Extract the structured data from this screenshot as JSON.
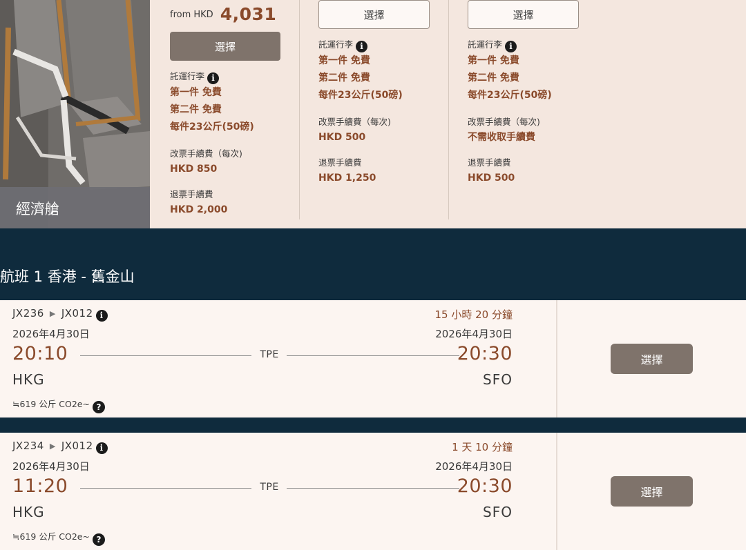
{
  "cabin": {
    "label": "經濟艙"
  },
  "fares": [
    {
      "from_label": "from HKD",
      "from_price": "4,031",
      "select_label": "選擇",
      "baggage_label": "託運行李",
      "baggage_lines": [
        "第一件 免費",
        "第二件 免費",
        "每件23公斤(50磅)"
      ],
      "change_fee_label": "改票手續費（每次)",
      "change_fee_value": "HKD 850",
      "refund_fee_label": "退票手續費",
      "refund_fee_value": "HKD 2,000"
    },
    {
      "select_label": "選擇",
      "baggage_label": "託運行李",
      "baggage_lines": [
        "第一件 免費",
        "第二件 免費",
        "每件23公斤(50磅)"
      ],
      "change_fee_label": "改票手續費（每次)",
      "change_fee_value": "HKD 500",
      "refund_fee_label": "退票手續費",
      "refund_fee_value": "HKD 1,250"
    },
    {
      "select_label": "選擇",
      "baggage_label": "託運行李",
      "baggage_lines": [
        "第一件 免費",
        "第二件 免費",
        "每件23公斤(50磅)"
      ],
      "change_fee_label": "改票手續費（每次)",
      "change_fee_value": "不需收取手續費",
      "refund_fee_label": "退票手續費",
      "refund_fee_value": "HKD 500"
    }
  ],
  "route": {
    "title": "航班 1 香港 - 舊金山"
  },
  "flights": [
    {
      "flight_a": "JX236",
      "flight_b": "JX012",
      "duration": "15 小時 20 分鐘",
      "depart_date": "2026年4月30日",
      "arrive_date": "2026年4月30日",
      "depart_time": "20:10",
      "arrive_time": "20:30",
      "stop": "TPE",
      "origin": "HKG",
      "destination": "SFO",
      "co2": "≒619 公斤 CO2e~",
      "select_label": "選擇"
    },
    {
      "flight_a": "JX234",
      "flight_b": "JX012",
      "duration": "1 天 10 分鐘",
      "depart_date": "2026年4月30日",
      "arrive_date": "2026年4月30日",
      "depart_time": "11:20",
      "arrive_time": "20:30",
      "stop": "TPE",
      "origin": "HKG",
      "destination": "SFO",
      "co2": "≒619 公斤 CO2e~",
      "select_label": "選擇"
    }
  ],
  "icons": {
    "info": "info-icon",
    "help": "question-icon",
    "arrow": "play-arrow-icon"
  },
  "colors": {
    "accent": "#8a4a2b",
    "button": "#7f736b",
    "panel": "#f4e7df",
    "header": "#0f2b3d"
  }
}
